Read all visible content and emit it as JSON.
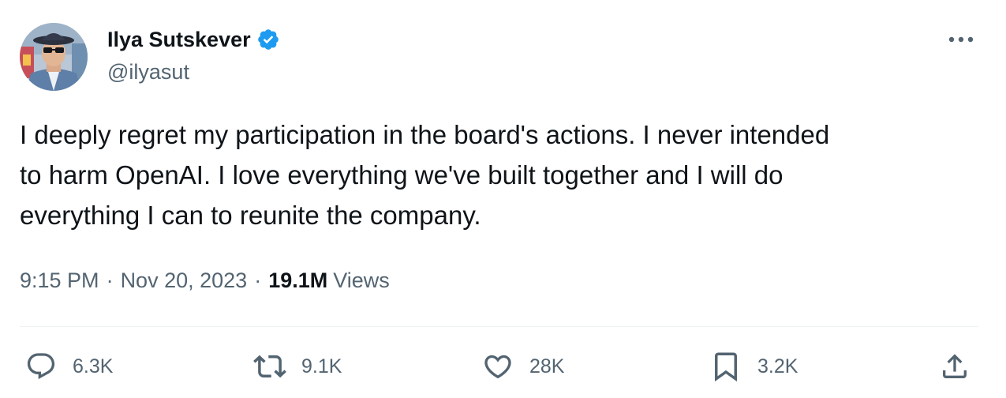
{
  "author": {
    "display_name": "Ilya Sutskever",
    "handle": "@ilyasut",
    "verified": true,
    "verified_color": "#1d9bf0",
    "avatar_icon": "profile-photo"
  },
  "tweet": {
    "text": "I deeply regret my participation in the board's actions. I never intended\nto harm OpenAI. I love everything we've built together and I will do\neverything I can to reunite the company.",
    "time": "9:15 PM",
    "separator": "·",
    "date": "Nov 20, 2023",
    "views_count": "19.1M",
    "views_label": "Views"
  },
  "actions": {
    "reply": {
      "icon": "reply-icon",
      "count": "6.3K"
    },
    "retweet": {
      "icon": "retweet-icon",
      "count": "9.1K"
    },
    "like": {
      "icon": "heart-icon",
      "count": "28K"
    },
    "bookmark": {
      "icon": "bookmark-icon",
      "count": "3.2K"
    },
    "share": {
      "icon": "share-icon"
    }
  },
  "colors": {
    "text_primary": "#0f1419",
    "text_secondary": "#536471",
    "divider": "#eff3f4",
    "accent": "#1d9bf0"
  }
}
